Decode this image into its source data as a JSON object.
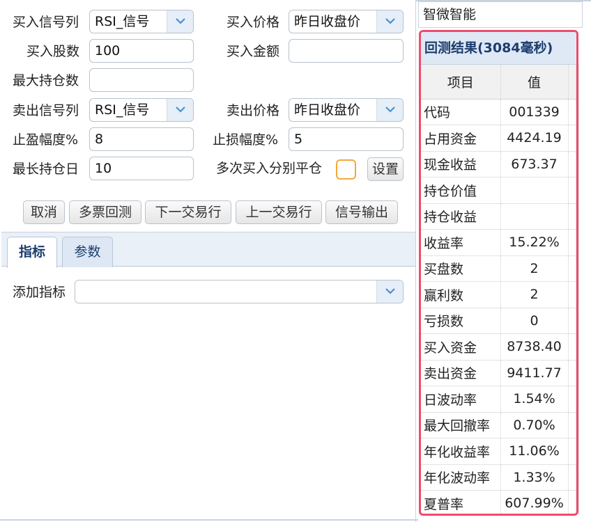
{
  "form": {
    "buy_signal_label": "买入信号列",
    "buy_signal_value": "RSI_信号",
    "buy_price_label": "买入价格",
    "buy_price_value": "昨日收盘价",
    "buy_shares_label": "买入股数",
    "buy_shares_value": "100",
    "buy_amount_label": "买入金额",
    "buy_amount_value": "",
    "max_positions_label": "最大持仓数",
    "max_positions_value": "",
    "sell_signal_label": "卖出信号列",
    "sell_signal_value": "RSI_信号",
    "sell_price_label": "卖出价格",
    "sell_price_value": "昨日收盘价",
    "take_profit_label": "止盈幅度%",
    "take_profit_value": "8",
    "stop_loss_label": "止损幅度%",
    "stop_loss_value": "5",
    "max_hold_days_label": "最长持仓日",
    "max_hold_days_value": "10",
    "multi_buy_label": "多次买入分别平仓",
    "multi_buy_checked": false,
    "settings_label": "设置"
  },
  "toolbar": {
    "cancel": "取消",
    "multi_backtest": "多票回测",
    "next_trade": "下一交易行",
    "prev_trade": "上一交易行",
    "signal_output": "信号输出"
  },
  "tabs": [
    {
      "label": "指标",
      "active": true
    },
    {
      "label": "参数",
      "active": false
    }
  ],
  "indicator": {
    "label": "添加指标",
    "value": ""
  },
  "side": {
    "header": "智微智能",
    "results_title": "回测结果(3084毫秒)",
    "columns": [
      "项目",
      "值"
    ],
    "rows": [
      {
        "key": "代码",
        "value": "001339"
      },
      {
        "key": "占用资金",
        "value": "4424.19"
      },
      {
        "key": "现金收益",
        "value": "673.37"
      },
      {
        "key": "持仓价值",
        "value": ""
      },
      {
        "key": "持仓收益",
        "value": ""
      },
      {
        "key": "收益率",
        "value": "15.22%"
      },
      {
        "key": "买盘数",
        "value": "2"
      },
      {
        "key": "赢利数",
        "value": "2"
      },
      {
        "key": "亏损数",
        "value": "0"
      },
      {
        "key": "买入资金",
        "value": "8738.40"
      },
      {
        "key": "卖出资金",
        "value": "9411.77"
      },
      {
        "key": "日波动率",
        "value": "1.54%"
      },
      {
        "key": "最大回撤率",
        "value": "0.70%"
      },
      {
        "key": "年化收益率",
        "value": "11.06%"
      },
      {
        "key": "年化波动率",
        "value": "1.33%"
      },
      {
        "key": "夏普率",
        "value": "607.99%"
      }
    ]
  },
  "colors": {
    "highlight_border": "#ef4b6c",
    "title_text": "#1c3d6e",
    "checkbox_border": "#f4a93a"
  }
}
